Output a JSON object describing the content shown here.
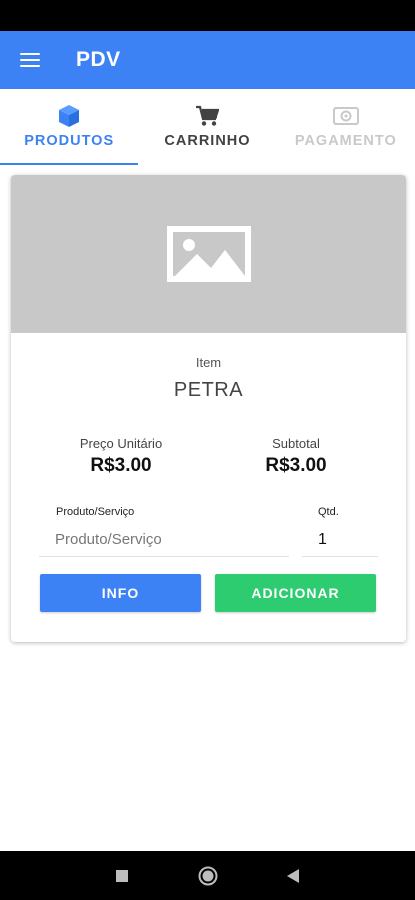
{
  "app_bar": {
    "title": "PDV",
    "color": "#3d82f5",
    "menu_icon": "hamburger-menu-icon"
  },
  "tabs": [
    {
      "label": "PRODUTOS",
      "icon": "cube-icon",
      "state": "active"
    },
    {
      "label": "CARRINHO",
      "icon": "cart-icon",
      "state": "normal"
    },
    {
      "label": "PAGAMENTO",
      "icon": "payment-icon",
      "state": "disabled"
    }
  ],
  "product": {
    "image_icon": "image-placeholder-icon",
    "item_caption": "Item",
    "item_name": "PETRA",
    "unit_price_label": "Preço Unitário",
    "unit_price_value": "R$3.00",
    "subtotal_label": "Subtotal",
    "subtotal_value": "R$3.00",
    "product_field_label": "Produto/Serviço",
    "product_field_placeholder": "Produto/Serviço",
    "product_field_value": "",
    "qty_label": "Qtd.",
    "qty_value": "1"
  },
  "buttons": {
    "info_label": "INFO",
    "add_label": "ADICIONAR",
    "info_color": "#3d82f5",
    "add_color": "#2ecc71"
  },
  "nav": {
    "recents_icon": "square-recents-icon",
    "home_icon": "circle-home-icon",
    "back_icon": "triangle-back-icon"
  }
}
